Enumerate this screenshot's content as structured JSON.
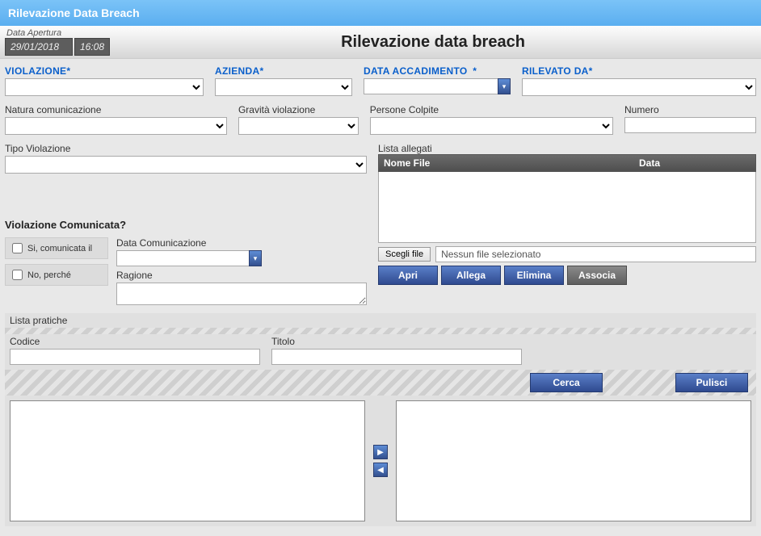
{
  "window": {
    "title": "Rilevazione Data Breach"
  },
  "header": {
    "open_date_label": "Data Apertura",
    "open_date": "29/01/2018",
    "open_time": "16:08",
    "page_title": "Rilevazione data breach"
  },
  "fields": {
    "violazione": {
      "label": "VIOLAZIONE"
    },
    "azienda": {
      "label": "AZIENDA"
    },
    "data_accadimento": {
      "label": "DATA ACCADIMENTO",
      "value": ""
    },
    "rilevato_da": {
      "label": "RILEVATO DA"
    },
    "natura": {
      "label": "Natura comunicazione"
    },
    "gravita": {
      "label": "Gravità violazione"
    },
    "persone": {
      "label": "Persone Colpite"
    },
    "numero": {
      "label": "Numero",
      "value": ""
    },
    "tipo_violazione": {
      "label": "Tipo Violazione"
    }
  },
  "comunicata": {
    "section": "Violazione Comunicata?",
    "yes": "Si, comunicata il",
    "no": "No, perché",
    "data_label": "Data Comunicazione",
    "data_value": "",
    "ragione_label": "Ragione",
    "ragione_value": ""
  },
  "allegati": {
    "label": "Lista allegati",
    "col_nome": "Nome File",
    "col_data": "Data",
    "choose": "Scegli file",
    "nofile": "Nessun file selezionato",
    "btn_apri": "Apri",
    "btn_allega": "Allega",
    "btn_elimina": "Elimina",
    "btn_associa": "Associa"
  },
  "pratiche": {
    "label": "Lista pratiche",
    "codice_label": "Codice",
    "codice_value": "",
    "titolo_label": "Titolo",
    "titolo_value": "",
    "cerca": "Cerca",
    "pulisci": "Pulisci"
  }
}
